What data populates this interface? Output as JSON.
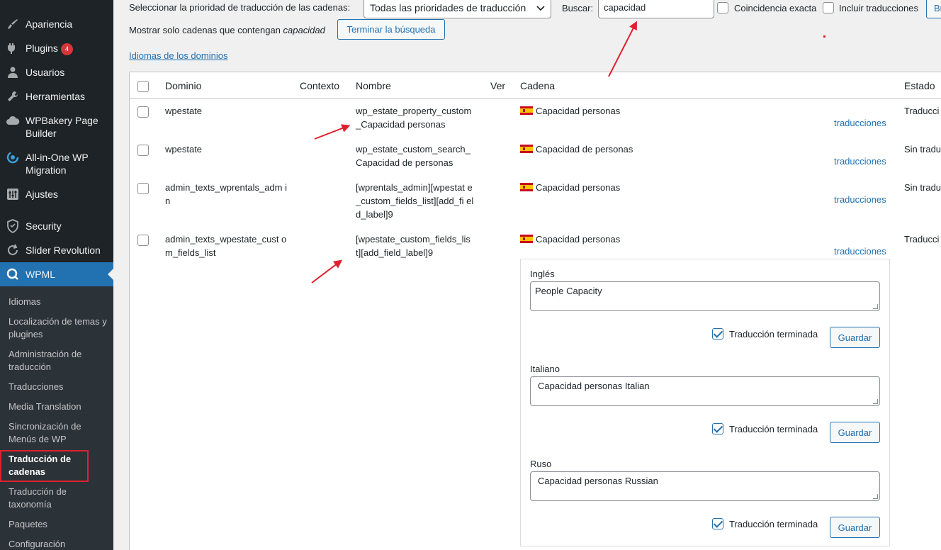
{
  "sidebar": {
    "items": [
      {
        "label": "Apariencia",
        "icon": "paintbrush-icon"
      },
      {
        "label": "Plugins",
        "icon": "plugin-icon",
        "badge": "4"
      },
      {
        "label": "Usuarios",
        "icon": "user-icon"
      },
      {
        "label": "Herramientas",
        "icon": "wrench-icon"
      },
      {
        "label": "WPBakery Page Builder",
        "icon": "cloud-icon"
      },
      {
        "label": "All-in-One WP Migration",
        "icon": "migration-icon"
      },
      {
        "label": "Ajustes",
        "icon": "settings-icon"
      },
      {
        "label": "Security",
        "icon": "shield-icon"
      },
      {
        "label": "Slider Revolution",
        "icon": "refresh-icon"
      },
      {
        "label": "WPML",
        "icon": "wpml-icon"
      }
    ],
    "submenu": [
      "Idiomas",
      "Localización de temas y plugines",
      "Administración de traducción",
      "Traducciones",
      "Media Translation",
      "Sincronización de Menús de WP",
      "Traducción de cadenas",
      "Traducción de taxonomía",
      "Paquetes",
      "Configuración"
    ]
  },
  "filters": {
    "priority_label": "Seleccionar la prioridad de traducción de las cadenas:",
    "priority_value": "Todas las prioridades de traducción",
    "search_label": "Buscar:",
    "search_value": "capacidad",
    "exact_match_label": "Coincidencia exacta",
    "include_translations_label": "Incluir traducciones",
    "search_button": "Bu",
    "showing_prefix": "Mostrar solo cadenas que contengan",
    "showing_term": "capacidad",
    "end_search_button": "Terminar la búsqueda",
    "domain_languages_link": "Idiomas de los dominios"
  },
  "table": {
    "headers": {
      "domain": "Dominio",
      "context": "Contexto",
      "name": "Nombre",
      "view": "Ver",
      "string": "Cadena",
      "status": "Estado"
    },
    "rows": [
      {
        "domain": "wpestate",
        "name": "wp_estate_property_custom _Capacidad personas",
        "string": "Capacidad personas",
        "link": "traducciones",
        "status": "Traducci"
      },
      {
        "domain": "wpestate",
        "name": "wp_estate_custom_search_ Capacidad de personas",
        "string": "Capacidad de personas",
        "link": "traducciones",
        "status": "Sin tradu"
      },
      {
        "domain": "admin_texts_wprentals_adm in",
        "name": "[wprentals_admin][wpestat e_custom_fields_list][add_fi eld_label]9",
        "string": "Capacidad personas",
        "link": "traducciones",
        "status": "Sin tradu"
      },
      {
        "domain": "admin_texts_wpestate_cust om_fields_list",
        "name": "[wpestate_custom_fields_lis t][add_field_label]9",
        "string": "Capacidad personas",
        "link": "traducciones",
        "status": "Traducci"
      }
    ]
  },
  "translations": [
    {
      "language": "Inglés",
      "value": "People Capacity",
      "done_label": "Traducción terminada",
      "done": true,
      "save": "Guardar"
    },
    {
      "language": "Italiano",
      "value": "Capacidad personas  Italian",
      "done_label": "Traducción terminada",
      "done": true,
      "save": "Guardar"
    },
    {
      "language": "Ruso",
      "value": "Capacidad personas Russian",
      "done_label": "Traducción terminada",
      "done": true,
      "save": "Guardar"
    }
  ],
  "colors": {
    "accent": "#2271b1",
    "sidebar": "#1d2327",
    "annotation": "#e0202f"
  }
}
